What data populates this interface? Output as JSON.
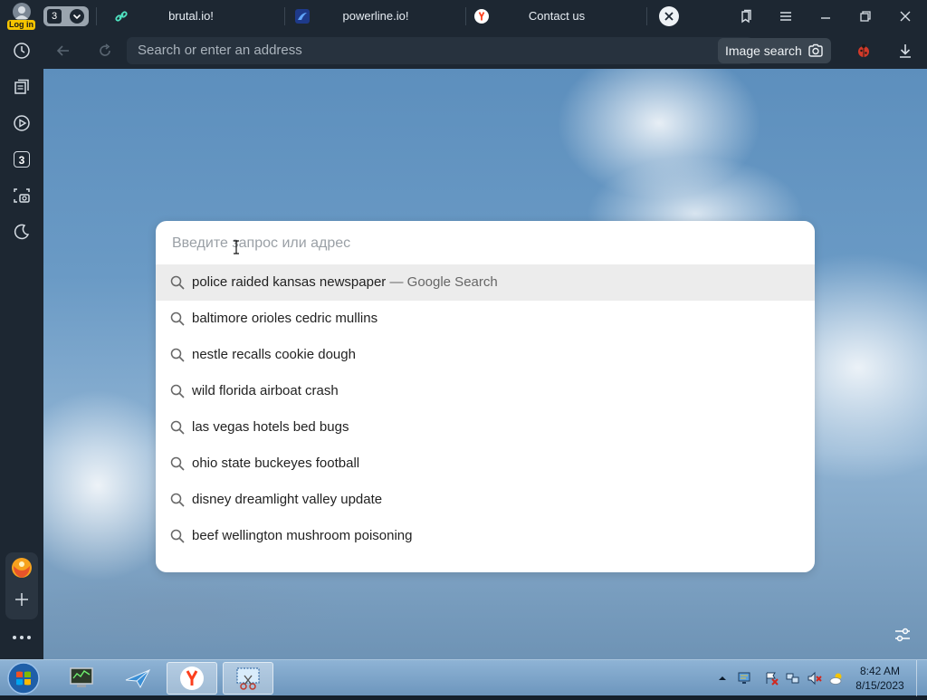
{
  "titlebar": {
    "tab_count": "3",
    "login_label": "Log in",
    "tabs": [
      {
        "label": "brutal.io!",
        "icon": "link-icon"
      },
      {
        "label": "powerline.io!",
        "icon": "powerline-icon"
      },
      {
        "label": "Contact us",
        "icon": "yandex-icon"
      }
    ]
  },
  "toolbar": {
    "address_placeholder": "Search or enter an address",
    "image_search_label": "Image search"
  },
  "search": {
    "placeholder": "Введите запрос или адрес",
    "suggestions": [
      {
        "text": "police raided kansas newspaper",
        "hint": " — Google Search"
      },
      {
        "text": "baltimore orioles cedric mullins",
        "hint": ""
      },
      {
        "text": "nestle recalls cookie dough",
        "hint": ""
      },
      {
        "text": "wild florida airboat crash",
        "hint": ""
      },
      {
        "text": "las vegas hotels bed bugs",
        "hint": ""
      },
      {
        "text": "ohio state buckeyes football",
        "hint": ""
      },
      {
        "text": "disney dreamlight valley update",
        "hint": ""
      },
      {
        "text": "beef wellington mushroom poisoning",
        "hint": ""
      }
    ]
  },
  "sidebar": {
    "tabs_badge": "3"
  },
  "taskbar": {
    "time": "8:42 AM",
    "date": "8/15/2023"
  },
  "colors": {
    "chrome_bg": "#1d2732",
    "address_bg": "#27323e",
    "active_row": "#ececec",
    "yandex_red": "#fc3f1d"
  }
}
